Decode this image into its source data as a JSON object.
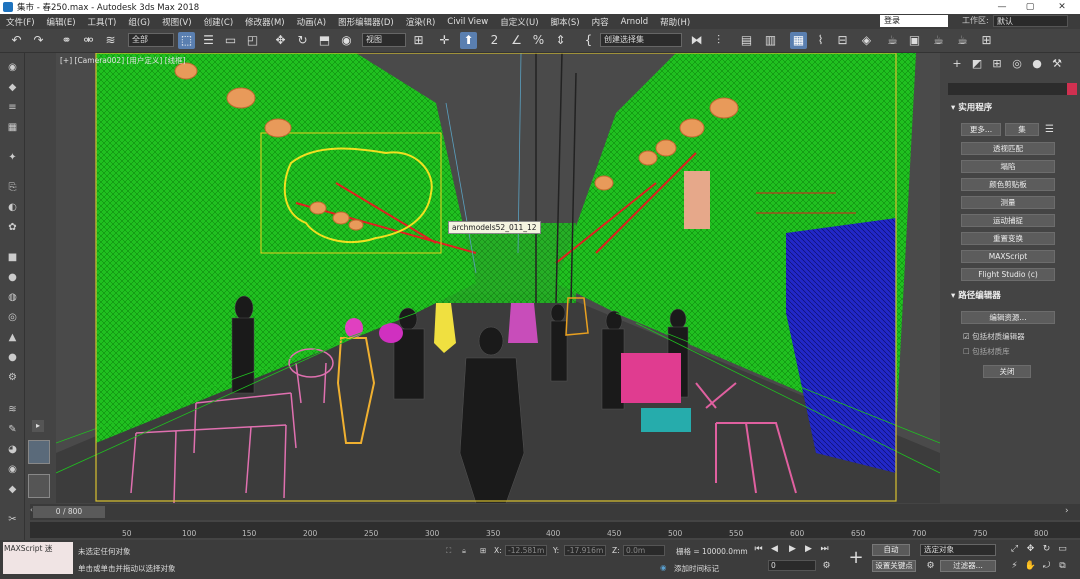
{
  "titlebar": {
    "title": "集市 - 春250.max - Autodesk 3ds Max 2018",
    "min": "—",
    "max": "▢",
    "close": "✕"
  },
  "menu": {
    "items": [
      "文件(F)",
      "编辑(E)",
      "工具(T)",
      "组(G)",
      "视图(V)",
      "创建(C)",
      "修改器(M)",
      "动画(A)",
      "图形编辑器(D)",
      "渲染(R)",
      "Civil View",
      "自定义(U)",
      "脚本(S)",
      "内容",
      "Arnold",
      "帮助(H)"
    ],
    "login": "登录",
    "workspace_label": "工作区:",
    "workspace_value": "默认"
  },
  "toolbar": {
    "filter": "全部",
    "refcoord": "视图",
    "named_selection": "创建选择集"
  },
  "viewport": {
    "label": "[+] [Camera002] [用户定义] [线框]",
    "tooltip": "archmodels52_011_12"
  },
  "cmdpanel": {
    "utilities_header": "实用程序",
    "more": "更多...",
    "sets": "集",
    "utilities": [
      "透视匹配",
      "塌陷",
      "颜色剪贴板",
      "测量",
      "运动捕捉",
      "重置变换",
      "MAXScript",
      "Flight Studio (c)"
    ],
    "path_header": "路径编辑器",
    "edit_resources": "编辑资源...",
    "include_material_editor": "包括材质编辑器",
    "include_material_library": "包括材质库",
    "close": "关闭"
  },
  "timeline": {
    "frame": "0 / 800",
    "ticks": [
      "50",
      "100",
      "150",
      "200",
      "250",
      "300",
      "350",
      "400",
      "450",
      "500",
      "550",
      "600",
      "650",
      "700",
      "750",
      "800"
    ]
  },
  "status": {
    "maxscript": "MAXScript 迷",
    "line1": "未选定任何对象",
    "line2": "单击或单击并拖动以选择对象",
    "x_label": "X:",
    "x_value": "-12.581m",
    "y_label": "Y:",
    "y_value": "-17.916m",
    "z_label": "Z:",
    "z_value": "0.0m",
    "grid": "栅格 = 10000.0mm",
    "add_time_tag": "添加时间标记",
    "auto": "自动",
    "set_key": "设置关键点",
    "selected": "选定对象",
    "key_filters": "过滤器...",
    "frame_value": "0"
  },
  "colors": {
    "wire_green": "#22c822",
    "wire_red": "#e02020",
    "wire_blue": "#2a30d0",
    "wire_pink": "#e23ea8",
    "wire_yellow": "#f0d020"
  }
}
